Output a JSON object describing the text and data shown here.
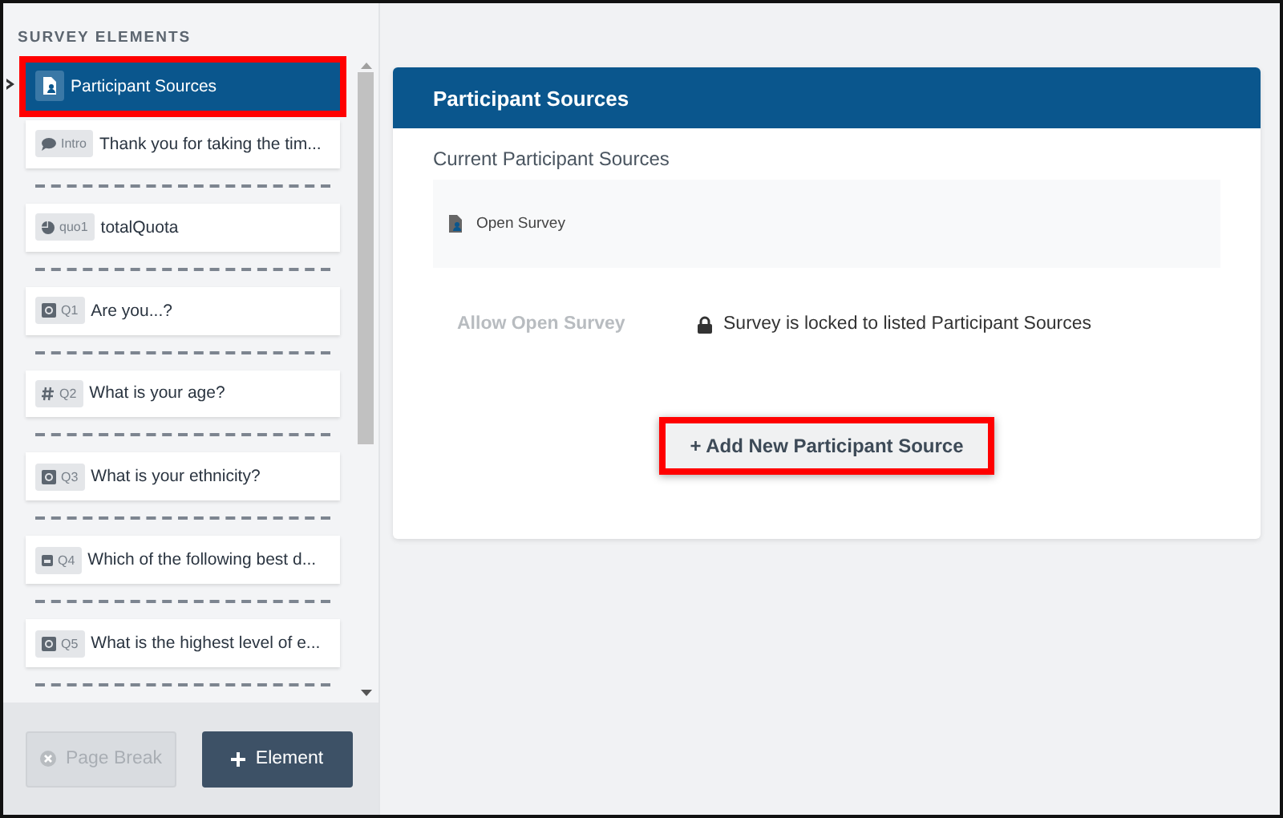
{
  "sidebar": {
    "title": "SURVEY ELEMENTS",
    "items": [
      {
        "kind": "sources",
        "text": "Participant Sources",
        "selected": true,
        "highlighted": true
      },
      {
        "kind": "intro",
        "tag": "Intro",
        "text": "Thank you for taking the tim...",
        "selected": false,
        "highlighted": false
      },
      {
        "kind": "page-break"
      },
      {
        "kind": "quota",
        "tag": "quo1",
        "text": "totalQuota",
        "selected": false,
        "highlighted": false
      },
      {
        "kind": "page-break"
      },
      {
        "kind": "choice",
        "tag": "Q1",
        "text": "Are you...?",
        "selected": false,
        "highlighted": false
      },
      {
        "kind": "page-break"
      },
      {
        "kind": "number",
        "tag": "Q2",
        "text": "What is your age?",
        "selected": false,
        "highlighted": false
      },
      {
        "kind": "page-break"
      },
      {
        "kind": "choice",
        "tag": "Q3",
        "text": "What is your ethnicity?",
        "selected": false,
        "highlighted": false
      },
      {
        "kind": "page-break"
      },
      {
        "kind": "dropdown",
        "tag": "Q4",
        "text": "Which of the following best d...",
        "selected": false,
        "highlighted": false
      },
      {
        "kind": "page-break"
      },
      {
        "kind": "choice",
        "tag": "Q5",
        "text": "What is the highest level of e...",
        "selected": false,
        "highlighted": false
      },
      {
        "kind": "page-break"
      }
    ],
    "buttons": [
      {
        "kind": "page-break",
        "label": "Page Break",
        "disabled": true
      },
      {
        "kind": "element",
        "label": "Element",
        "disabled": false
      }
    ]
  },
  "panel": {
    "title": "Participant Sources",
    "section_title": "Current Participant Sources",
    "sources": [
      {
        "label": "Open Survey"
      }
    ],
    "toggle_label": "Allow Open Survey",
    "toggle_disabled": true,
    "lock_message": "Survey is locked to listed Participant Sources",
    "add_button": {
      "label": "+ Add New Participant Source",
      "highlighted": true
    }
  }
}
